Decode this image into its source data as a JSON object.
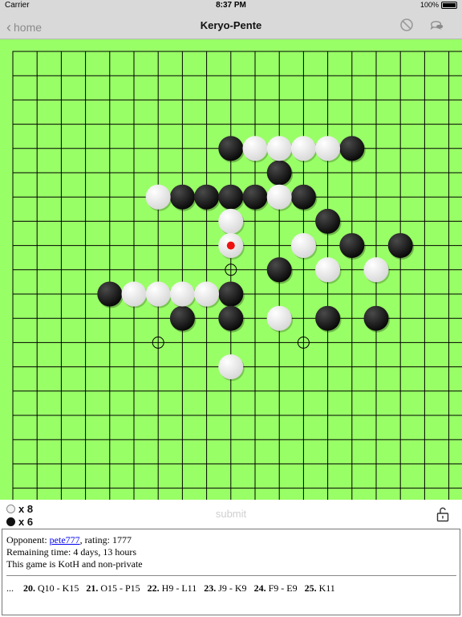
{
  "status_bar": {
    "carrier": "Carrier",
    "time": "8:37 PM",
    "battery": "100%"
  },
  "nav": {
    "back_label": "home",
    "title": "Keryo-Pente",
    "icons": [
      "no-entry-icon",
      "chat-bubbles-icon"
    ]
  },
  "board": {
    "size": 19,
    "colors": {
      "background": "#99ff66",
      "grid": "#000000",
      "black_stone": "#111111",
      "white_stone": "#f2f2f2",
      "last_move_marker": "#ee1111"
    },
    "black_stones": [
      [
        9,
        4
      ],
      [
        14,
        4
      ],
      [
        11,
        5
      ],
      [
        7,
        6
      ],
      [
        8,
        6
      ],
      [
        9,
        6
      ],
      [
        10,
        6
      ],
      [
        12,
        6
      ],
      [
        13,
        7
      ],
      [
        14,
        8
      ],
      [
        16,
        8
      ],
      [
        11,
        9
      ],
      [
        4,
        10
      ],
      [
        9,
        10
      ],
      [
        7,
        11
      ],
      [
        9,
        11
      ],
      [
        13,
        11
      ],
      [
        15,
        11
      ]
    ],
    "white_stones": [
      [
        10,
        4
      ],
      [
        11,
        4
      ],
      [
        12,
        4
      ],
      [
        13,
        4
      ],
      [
        6,
        6
      ],
      [
        11,
        6
      ],
      [
        9,
        7
      ],
      [
        9,
        8
      ],
      [
        12,
        8
      ],
      [
        13,
        9
      ],
      [
        15,
        9
      ],
      [
        5,
        10
      ],
      [
        6,
        10
      ],
      [
        7,
        10
      ],
      [
        8,
        10
      ],
      [
        11,
        11
      ],
      [
        9,
        13
      ]
    ],
    "last_move": [
      9,
      8
    ],
    "markers": [
      [
        9,
        9
      ],
      [
        6,
        12
      ],
      [
        12,
        12
      ]
    ]
  },
  "captures": {
    "white_count": "x 8",
    "black_count": "x 6"
  },
  "actions": {
    "submit_label": "submit"
  },
  "info": {
    "opponent_label": "Opponent: ",
    "opponent_name": "pete777",
    "opponent_rating": ", rating: 1777",
    "remaining_time": "Remaining time: 4 days, 13 hours",
    "game_type": "This game is KotH and non-private",
    "moves_prefix": "...",
    "moves": [
      {
        "num": "20.",
        "text": "Q10 - K15"
      },
      {
        "num": "21.",
        "text": "O15 - P15"
      },
      {
        "num": "22.",
        "text": "H9 - L11"
      },
      {
        "num": "23.",
        "text": "J9 - K9"
      },
      {
        "num": "24.",
        "text": "F9 - E9"
      },
      {
        "num": "25.",
        "text": "K11"
      }
    ]
  }
}
